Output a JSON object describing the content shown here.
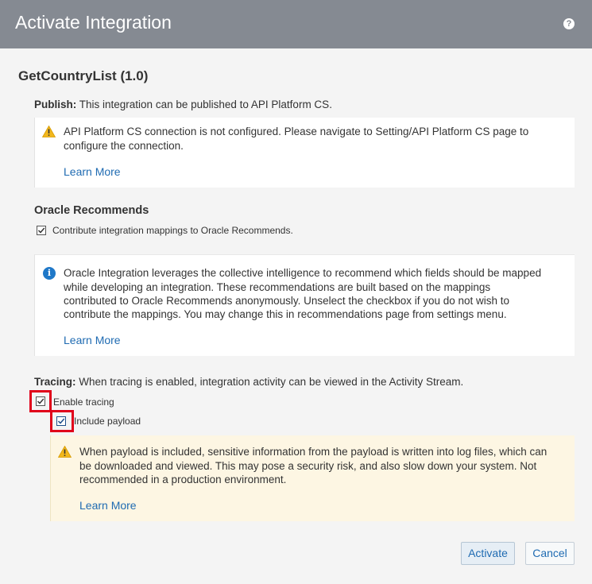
{
  "dialog": {
    "title": "Activate Integration",
    "help_icon": "?",
    "integration_name": "GetCountryList (1.0)"
  },
  "publish": {
    "label": "Publish:",
    "text": "This integration can be published to API Platform CS.",
    "warning_line1": "API Platform CS connection is not configured. Please navigate to Setting/API Platform CS page to",
    "warning_line2": "configure the connection.",
    "learn_more": "Learn More"
  },
  "recommends": {
    "heading": "Oracle Recommends",
    "checkbox_label": "Contribute integration mappings to Oracle Recommends.",
    "checkbox_checked": true,
    "info_lines": [
      "Oracle Integration leverages the collective intelligence to recommend which fields should be mapped",
      "while developing an integration. These recommendations are built based on the mappings",
      "contributed to Oracle Recommends anonymously. Unselect the checkbox if you do not wish to",
      "contribute the mappings. You may change this in recommendations page from settings menu."
    ],
    "learn_more": "Learn More"
  },
  "tracing": {
    "label": "Tracing:",
    "text": "When tracing is enabled, integration activity can be viewed in the Activity Stream.",
    "enable_label": "Enable tracing",
    "enable_checked": true,
    "payload_label": "Include payload",
    "payload_checked": true,
    "warning_lines": [
      "When payload is included, sensitive information from the payload is written into log files, which can",
      "be downloaded and viewed. This may pose a security risk, and also slow down your system. Not",
      "recommended in a production environment."
    ],
    "learn_more": "Learn More"
  },
  "buttons": {
    "activate": "Activate",
    "cancel": "Cancel"
  },
  "colors": {
    "titlebar": "#858a92",
    "link": "#1f6bb2",
    "warning_bg": "#fdf6e3",
    "highlight": "#e0001a"
  }
}
